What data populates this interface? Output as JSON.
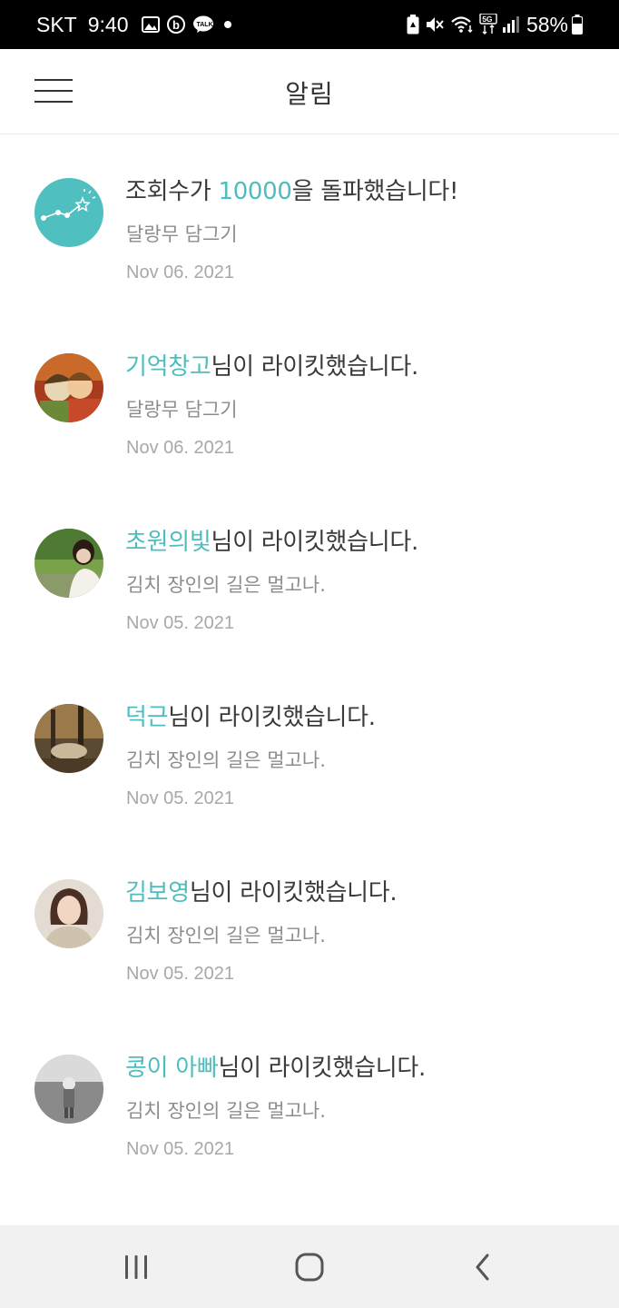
{
  "status_bar": {
    "carrier": "SKT",
    "time": "9:40",
    "network": "5G",
    "battery": "58%"
  },
  "header": {
    "title": "알림"
  },
  "notifications": [
    {
      "highlight_prefix": "조회수가 ",
      "highlight": "10000",
      "message": "을 돌파했습니다!",
      "sub": "달랑무 담그기",
      "date": "Nov 06. 2021"
    },
    {
      "highlight_prefix": "",
      "highlight": "기억창고",
      "message": "님이 라이킷했습니다.",
      "sub": "달랑무 담그기",
      "date": "Nov 06. 2021"
    },
    {
      "highlight_prefix": "",
      "highlight": "초원의빛",
      "message": "님이 라이킷했습니다.",
      "sub": "김치 장인의 길은 멀고나.",
      "date": "Nov 05. 2021"
    },
    {
      "highlight_prefix": "",
      "highlight": "덕근",
      "message": "님이 라이킷했습니다.",
      "sub": "김치 장인의 길은 멀고나.",
      "date": "Nov 05. 2021"
    },
    {
      "highlight_prefix": "",
      "highlight": "김보영",
      "message": "님이 라이킷했습니다.",
      "sub": "김치 장인의 길은 멀고나.",
      "date": "Nov 05. 2021"
    },
    {
      "highlight_prefix": "",
      "highlight": "콩이 아빠",
      "message": "님이 라이킷했습니다.",
      "sub": "김치 장인의 길은 멀고나.",
      "date": "Nov 05. 2021"
    }
  ],
  "colors": {
    "accent": "#4dbdbd",
    "stats_avatar_bg": "#4fbfbf"
  },
  "icons": {
    "menu": "hamburger-icon",
    "stats": "stats-star-chart-icon",
    "nav_recents": "recent-apps-icon",
    "nav_home": "home-icon",
    "nav_back": "back-icon"
  }
}
